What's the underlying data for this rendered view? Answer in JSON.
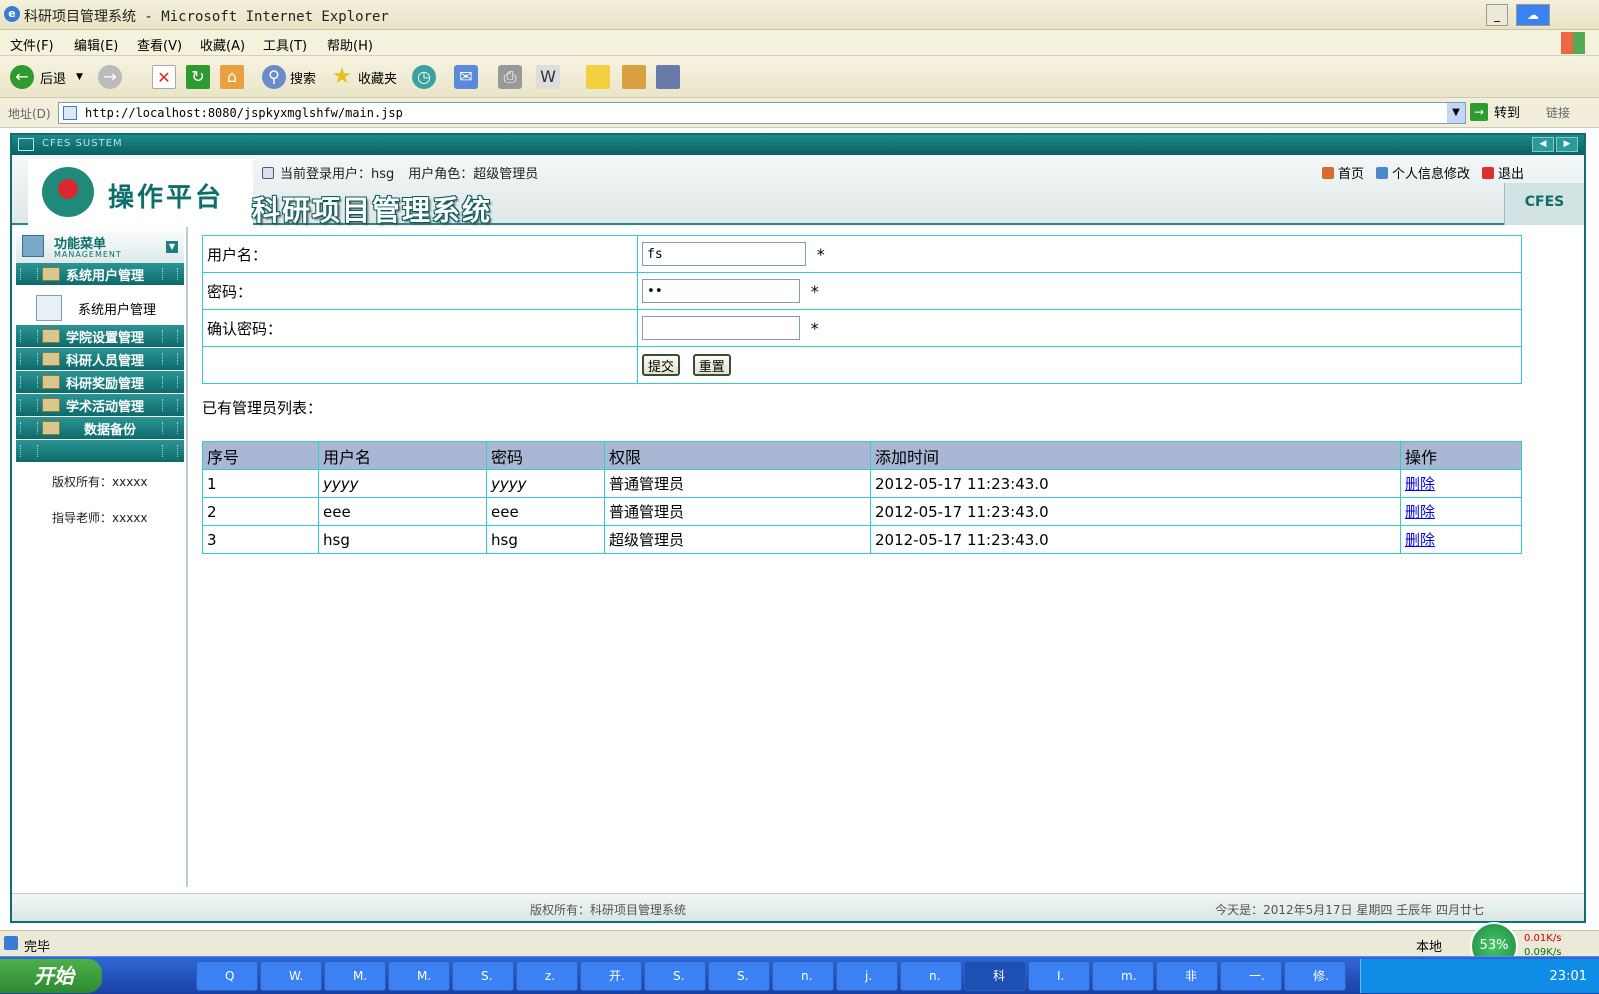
{
  "window": {
    "title": "科研项目管理系统 - Microsoft Internet Explorer"
  },
  "menu": [
    "文件(F)",
    "编辑(E)",
    "查看(V)",
    "收藏(A)",
    "工具(T)",
    "帮助(H)"
  ],
  "toolbar": {
    "back": "后退",
    "search": "搜索",
    "favorites": "收藏夹"
  },
  "address": {
    "label": "地址(D)",
    "url": "http://localhost:8080/jspkyxmglshfw/main.jsp",
    "go": "转到",
    "links": "链接"
  },
  "app": {
    "frame_title": "CFES SUSTEM",
    "logo_text": "操作平台",
    "system_title": "科研项目管理系统",
    "current_user": "当前登录用户：hsg",
    "user_role": "用户角色：超级管理员",
    "links": {
      "home": "首页",
      "profile": "个人信息修改",
      "logout": "退出"
    },
    "tag": "CFES"
  },
  "sidebar": {
    "title": "功能菜单",
    "subtitle": "MANAGEMENT",
    "items": [
      "系统用户管理",
      "学院设置管理",
      "科研人员管理",
      "科研奖励管理",
      "学术活动管理",
      "数据备份"
    ],
    "sub_item": "系统用户管理",
    "copyright": "版权所有：xxxxx",
    "advisor": "指导老师：xxxxx"
  },
  "form": {
    "username_label": "用户名：",
    "username_value": "fs",
    "password_label": "密码：",
    "password_value": "••",
    "confirm_label": "确认密码：",
    "confirm_value": "",
    "required": "*",
    "submit": "提交",
    "reset": "重置"
  },
  "list": {
    "title": "已有管理员列表：",
    "columns": [
      "序号",
      "用户名",
      "密码",
      "权限",
      "添加时间",
      "操作"
    ],
    "rows": [
      {
        "no": "1",
        "username": "yyyy",
        "password": "yyyy",
        "role": "普通管理员",
        "time": "2012-05-17 11:23:43.0",
        "action": "删除"
      },
      {
        "no": "2",
        "username": "eee",
        "password": "eee",
        "role": "普通管理员",
        "time": "2012-05-17 11:23:43.0",
        "action": "删除"
      },
      {
        "no": "3",
        "username": "hsg",
        "password": "hsg",
        "role": "超级管理员",
        "time": "2012-05-17 11:23:43.0",
        "action": "删除"
      }
    ]
  },
  "footer": {
    "copyright": "版权所有：科研项目管理系统",
    "date": "今天是：2012年5月17日 星期四 壬辰年 四月廿七"
  },
  "status": {
    "text": "完毕",
    "zone": "本地",
    "cpu": "53%",
    "up": "0.01K/s",
    "down": "0.09K/s"
  },
  "taskbar": {
    "start": "开始",
    "tasks": [
      "Q",
      "W.",
      "M.",
      "M.",
      "S.",
      "z.",
      "开.",
      "S.",
      "S.",
      "n.",
      "j.",
      "n.",
      "科",
      "I.",
      "m.",
      "非",
      "一.",
      "修."
    ],
    "clock": "23:01"
  }
}
